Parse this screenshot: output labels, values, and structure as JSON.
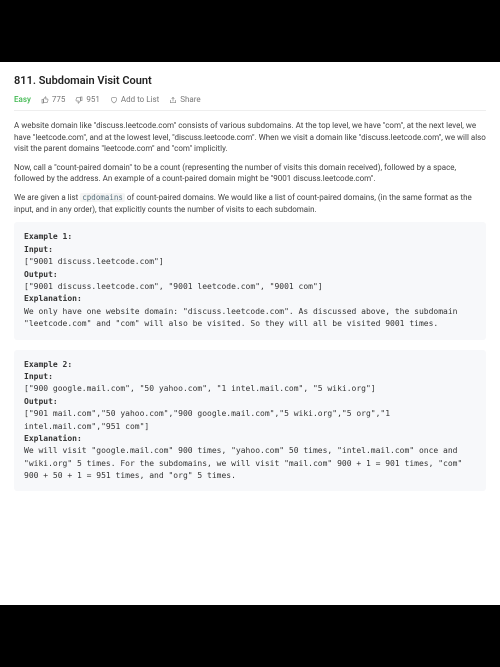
{
  "problem": {
    "number_title": "811. Subdomain Visit Count",
    "difficulty": "Easy",
    "likes": "775",
    "dislikes": "951",
    "add_to_list": "Add to List",
    "share": "Share"
  },
  "paragraphs": {
    "p1": "A website domain like \"discuss.leetcode.com\" consists of various subdomains. At the top level, we have \"com\", at the next level, we have \"leetcode.com\", and at the lowest level, \"discuss.leetcode.com\". When we visit a domain like \"discuss.leetcode.com\", we will also visit the parent domains \"leetcode.com\" and \"com\" implicitly.",
    "p2": "Now, call a \"count-paired domain\" to be a count (representing the number of visits this domain received), followed by a space, followed by the address. An example of a count-paired domain might be \"9001 discuss.leetcode.com\".",
    "p3_pre": "We are given a list ",
    "p3_code": "cpdomains",
    "p3_post": " of count-paired domains. We would like a list of count-paired domains, (in the same format as the input, and in any order), that explicitly counts the number of visits to each subdomain."
  },
  "examples": {
    "ex1": {
      "heading": "Example 1:",
      "input_label": "Input:",
      "input_val": "[\"9001 discuss.leetcode.com\"]",
      "output_label": "Output:",
      "output_val": "[\"9001 discuss.leetcode.com\", \"9001 leetcode.com\", \"9001 com\"]",
      "expl_label": "Explanation:",
      "expl_val": "We only have one website domain: \"discuss.leetcode.com\". As discussed above, the subdomain \"leetcode.com\" and \"com\" will also be visited. So they will all be visited 9001 times."
    },
    "ex2": {
      "heading": "Example 2:",
      "input_label": "Input:",
      "input_val": "[\"900 google.mail.com\", \"50 yahoo.com\", \"1 intel.mail.com\", \"5 wiki.org\"]",
      "output_label": "Output:",
      "output_val": "[\"901 mail.com\",\"50 yahoo.com\",\"900 google.mail.com\",\"5 wiki.org\",\"5 org\",\"1 intel.mail.com\",\"951 com\"]",
      "expl_label": "Explanation:",
      "expl_val": "We will visit \"google.mail.com\" 900 times, \"yahoo.com\" 50 times, \"intel.mail.com\" once and \"wiki.org\" 5 times. For the subdomains, we will visit \"mail.com\" 900 + 1 = 901 times, \"com\" 900 + 50 + 1 = 951 times, and \"org\" 5 times."
    }
  }
}
